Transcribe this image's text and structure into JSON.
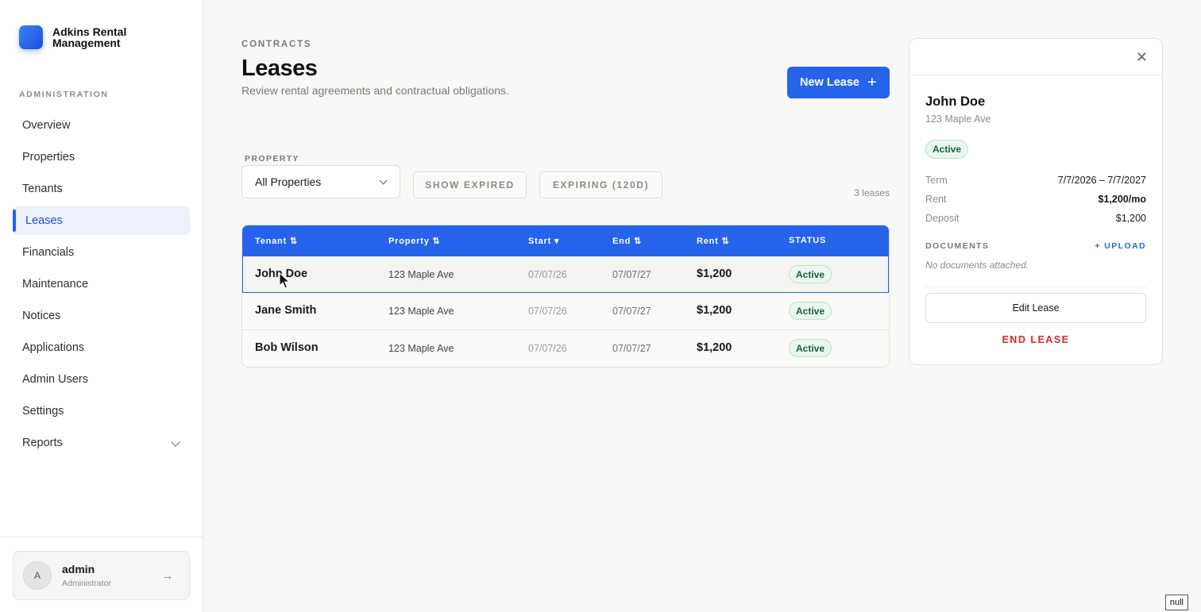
{
  "brand": {
    "name": "Adkins Rental Management"
  },
  "sidebar": {
    "section_label": "ADMINISTRATION",
    "items": [
      {
        "label": "Overview"
      },
      {
        "label": "Properties"
      },
      {
        "label": "Tenants"
      },
      {
        "label": "Leases",
        "active": true
      },
      {
        "label": "Financials"
      },
      {
        "label": "Maintenance"
      },
      {
        "label": "Notices"
      },
      {
        "label": "Applications"
      },
      {
        "label": "Admin Users"
      },
      {
        "label": "Settings"
      },
      {
        "label": "Reports",
        "icon": "chevron-down-icon"
      }
    ],
    "user": {
      "initial": "A",
      "name": "admin",
      "role": "Administrator",
      "action_icon": "arrow-right-icon"
    }
  },
  "header": {
    "eyebrow": "CONTRACTS",
    "title": "Leases",
    "subtitle": "Review rental agreements and contractual obligations.",
    "new_button": "New Lease",
    "new_button_icon": "plus-icon"
  },
  "filters": {
    "property_label": "PROPERTY",
    "property_value": "All Properties",
    "show_expired": "SHOW EXPIRED",
    "expiring": "EXPIRING (120D)",
    "count": "3 leases"
  },
  "table": {
    "columns": [
      "Tenant ⇅",
      "Property ⇅",
      "Start ▾",
      "End ⇅",
      "Rent ⇅",
      "STATUS"
    ],
    "rows": [
      {
        "tenant": "John Doe",
        "property": "123 Maple Ave",
        "start": "07/07/26",
        "end": "07/07/27",
        "rent": "$1,200",
        "status": "Active"
      },
      {
        "tenant": "Jane Smith",
        "property": "123 Maple Ave",
        "start": "07/07/26",
        "end": "07/07/27",
        "rent": "$1,200",
        "status": "Active"
      },
      {
        "tenant": "Bob Wilson",
        "property": "123 Maple Ave",
        "start": "07/07/26",
        "end": "07/07/27",
        "rent": "$1,200",
        "status": "Active"
      }
    ]
  },
  "detail": {
    "close_icon": "close-icon",
    "name": "John Doe",
    "address": "123 Maple Ave",
    "status": "Active",
    "term_label": "Term",
    "term_value": "7/7/2026 – 7/7/2027",
    "rent_label": "Rent",
    "rent_value": "$1,200/mo",
    "deposit_label": "Deposit",
    "deposit_value": "$1,200",
    "documents_label": "DOCUMENTS",
    "upload_label": "+ UPLOAD",
    "no_documents": "No documents attached.",
    "edit_button": "Edit Lease",
    "end_button": "END LEASE"
  },
  "footer_tag": "null",
  "colors": {
    "accent": "#2563eb",
    "danger": "#dc2626",
    "success_bg": "#e9f7f0"
  }
}
